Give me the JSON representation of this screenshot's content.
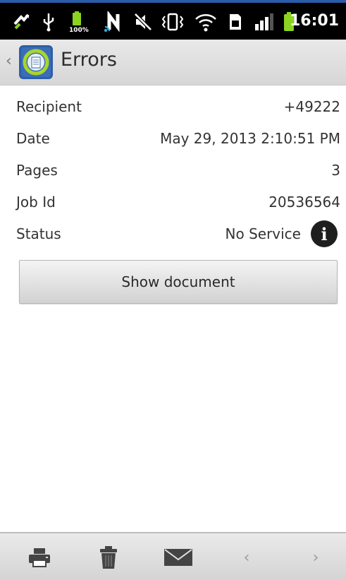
{
  "status_bar": {
    "time": "16:01",
    "battery_percent_label": "100%",
    "icons": [
      "sync-icon",
      "usb-icon",
      "battery-100-icon",
      "nfc-icon",
      "mute-icon",
      "vibrate-icon",
      "wifi-icon",
      "sim-icon",
      "signal-icon",
      "battery-icon"
    ]
  },
  "action_bar": {
    "title": "Errors",
    "icon": "fax-app-icon"
  },
  "details": [
    {
      "label": "Recipient",
      "value": "+49222"
    },
    {
      "label": "Date",
      "value": "May 29, 2013 2:10:51 PM"
    },
    {
      "label": "Pages",
      "value": "3"
    },
    {
      "label": "Job Id",
      "value": "20536564"
    },
    {
      "label": "Status",
      "value": "No Service",
      "icon": "info-icon"
    }
  ],
  "show_document_label": "Show document",
  "bottom_bar": {
    "icons": [
      "print-icon",
      "trash-icon",
      "mail-icon",
      "chevron-left-icon",
      "chevron-right-icon"
    ],
    "prev_label": "‹",
    "next_label": "›"
  },
  "colors": {
    "status_bar_bg": "#000000",
    "accent_line": "#2a5ba6",
    "battery_green": "#8bd41f"
  }
}
